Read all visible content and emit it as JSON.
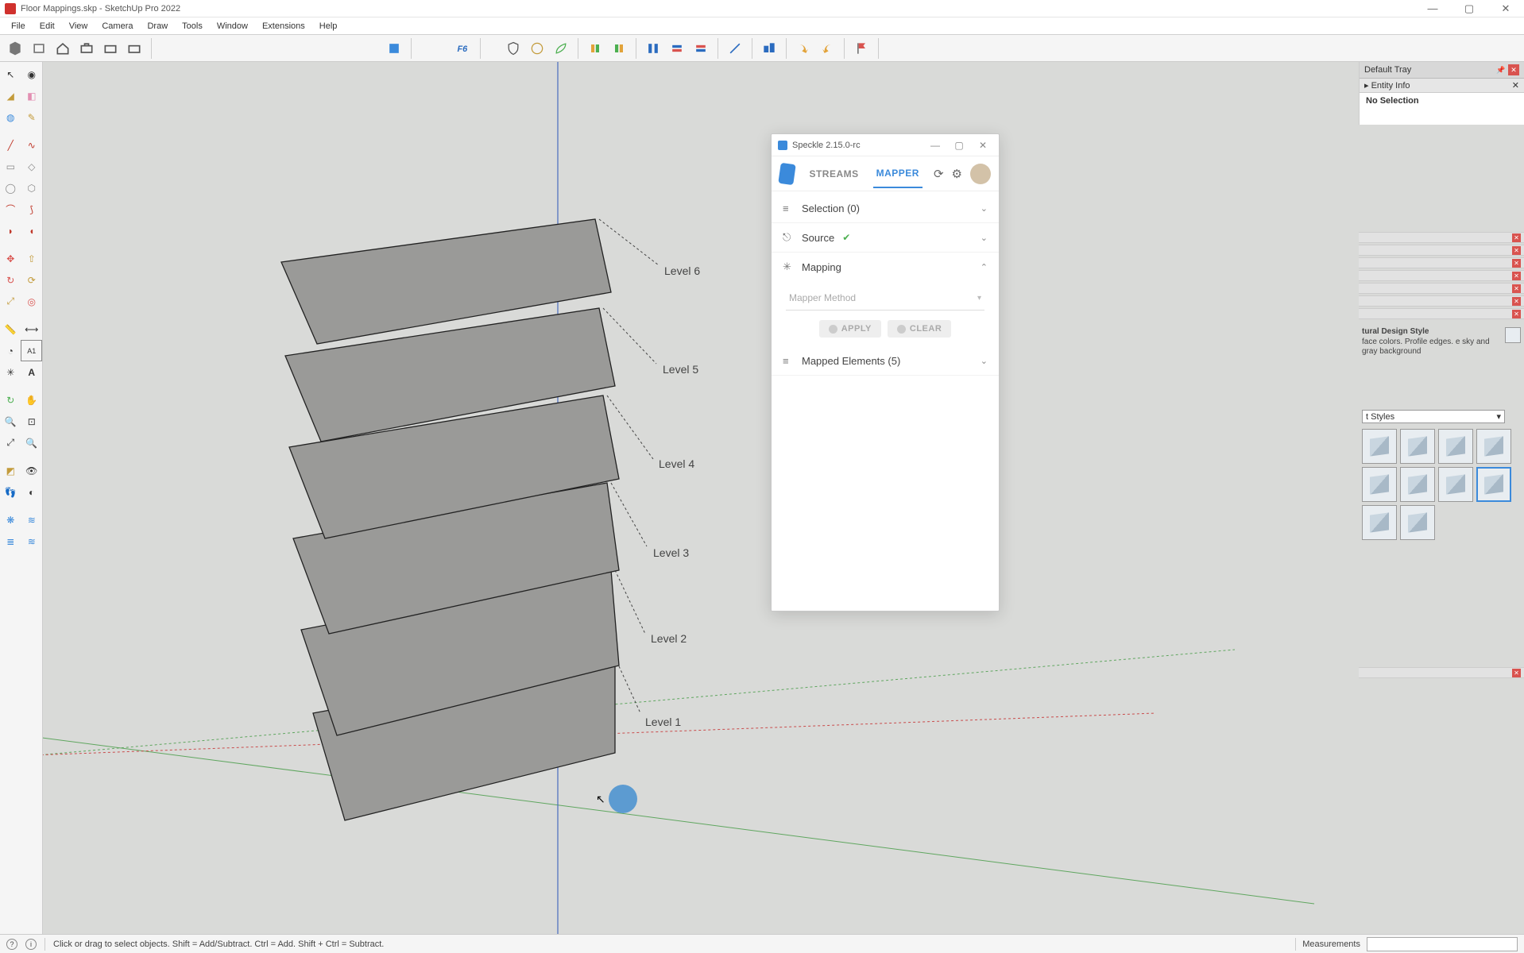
{
  "app": {
    "document_name": "Floor Mappings.skp",
    "app_name": "SketchUp Pro 2022",
    "title": "Floor Mappings.skp - SketchUp Pro 2022"
  },
  "menu": [
    "File",
    "Edit",
    "View",
    "Camera",
    "Draw",
    "Tools",
    "Window",
    "Extensions",
    "Help"
  ],
  "tray": {
    "title": "Default Tray",
    "panel1_title": "Entity Info",
    "panel1_body": "No Selection",
    "style_name": "tural Design Style",
    "style_desc": "face colors. Profile edges. e sky and gray background",
    "styles_label": "t Styles"
  },
  "levels": [
    "Level 1",
    "Level 2",
    "Level 3",
    "Level 4",
    "Level 5",
    "Level 6"
  ],
  "speckle": {
    "title": "Speckle 2.15.0-rc",
    "tabs": {
      "streams": "STREAMS",
      "mapper": "MAPPER"
    },
    "rows": {
      "selection": "Selection (0)",
      "source": "Source",
      "mapping": "Mapping",
      "mapped": "Mapped Elements (5)"
    },
    "method_placeholder": "Mapper Method",
    "buttons": {
      "apply": "APPLY",
      "clear": "CLEAR"
    }
  },
  "status": {
    "hint": "Click or drag to select objects. Shift = Add/Subtract. Ctrl = Add. Shift + Ctrl = Subtract.",
    "measurements_label": "Measurements"
  }
}
